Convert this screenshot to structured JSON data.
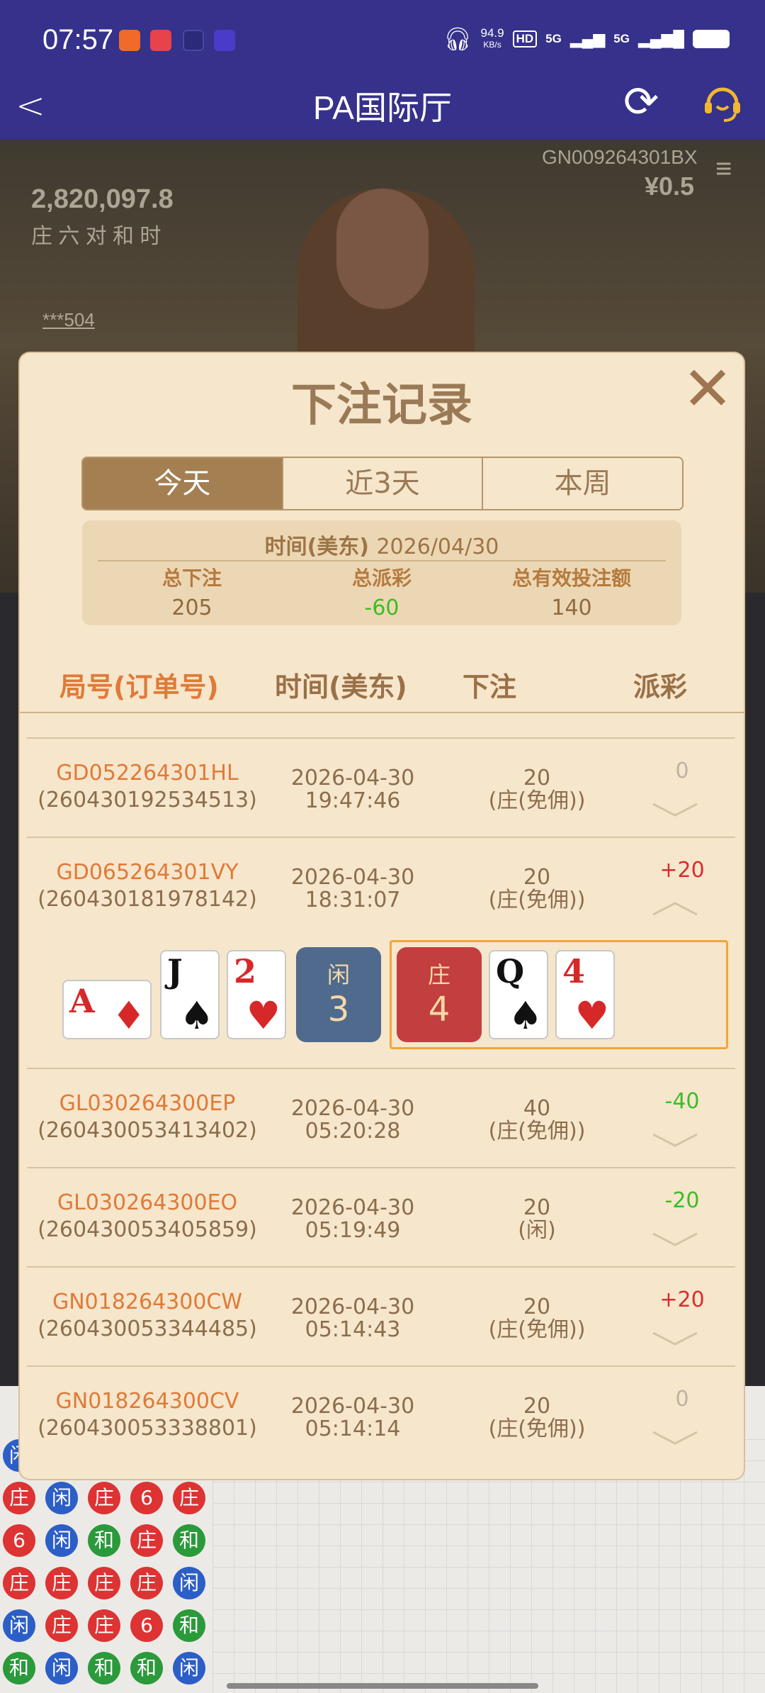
{
  "status_bar": {
    "time": "07:57",
    "net_speed": "94.9",
    "net_unit": "KB/s",
    "sig1": "5G",
    "sig2": "5G",
    "hd": "HD"
  },
  "header": {
    "title": "PA国际厅",
    "back_icon": "back-chevron-icon",
    "refresh_icon": "refresh-icon",
    "support_icon": "customer-service-icon"
  },
  "video": {
    "jackpot": "2,820,097.8",
    "table_code": "GN009264301BX",
    "min_bet": "¥0.5",
    "stats_row": "庄 六 对 和 时",
    "user_suffix": "***504"
  },
  "modal": {
    "title": "下注记录",
    "close_icon": "close-x-icon",
    "tabs": [
      {
        "label": "今天",
        "active": true
      },
      {
        "label": "近3天",
        "active": false
      },
      {
        "label": "本周",
        "active": false
      }
    ],
    "summary": {
      "date_label": "时间(美东)",
      "date": "2026/04/30",
      "total_bet_label": "总下注",
      "total_bet": "205",
      "total_payout_label": "总派彩",
      "total_payout": "-60",
      "valid_bet_label": "总有效投注额",
      "valid_bet": "140"
    },
    "columns": {
      "round": "局号(订单号)",
      "time": "时间(美东)",
      "bet": "下注",
      "payout": "派彩"
    },
    "rows": [
      {
        "round_id": "GD052264301HL",
        "order_no": "(260430192534513)",
        "date": "2026-04-30",
        "clock": "19:47:46",
        "amount": "20",
        "bet_type": "(庄(免佣))",
        "payout": "0",
        "expanded": false
      },
      {
        "round_id": "GD065264301VY",
        "order_no": "(260430181978142)",
        "date": "2026-04-30",
        "clock": "18:31:07",
        "amount": "20",
        "bet_type": "(庄(免佣))",
        "payout": "+20",
        "expanded": true
      },
      {
        "round_id": "GL030264300EP",
        "order_no": "(260430053413402)",
        "date": "2026-04-30",
        "clock": "05:20:28",
        "amount": "40",
        "bet_type": "(庄(免佣))",
        "payout": "-40",
        "expanded": false
      },
      {
        "round_id": "GL030264300EO",
        "order_no": "(260430053405859)",
        "date": "2026-04-30",
        "clock": "05:19:49",
        "amount": "20",
        "bet_type": "(闲)",
        "payout": "-20",
        "expanded": false
      },
      {
        "round_id": "GN018264300CW",
        "order_no": "(260430053344485)",
        "date": "2026-04-30",
        "clock": "05:14:43",
        "amount": "20",
        "bet_type": "(庄(免佣))",
        "payout": "+20",
        "expanded": false
      },
      {
        "round_id": "GN018264300CV",
        "order_no": "(260430053338801)",
        "date": "2026-04-30",
        "clock": "05:14:14",
        "amount": "20",
        "bet_type": "(庄(免佣))",
        "payout": "0",
        "expanded": false
      }
    ],
    "detail": {
      "player_cards": [
        {
          "rank": "A",
          "suit": "♦"
        },
        {
          "rank": "J",
          "suit": "♠"
        },
        {
          "rank": "2",
          "suit": "♥"
        }
      ],
      "player_label": "闲",
      "player_score": "3",
      "banker_label": "庄",
      "banker_score": "4",
      "banker_cards": [
        {
          "rank": "Q",
          "suit": "♠"
        },
        {
          "rank": "4",
          "suit": "♥"
        }
      ]
    }
  },
  "bead_road": [
    [
      "闲",
      "庄",
      "6",
      "庄",
      "闲",
      "和"
    ],
    [
      "",
      "闲",
      "闲",
      "庄",
      "庄",
      "闲"
    ],
    [
      "",
      "庄",
      "和",
      "庄",
      "庄",
      "和"
    ],
    [
      "",
      "6",
      "庄",
      "庄",
      "6",
      "和"
    ],
    [
      "",
      "庄",
      "和",
      "闲",
      "和",
      "闲"
    ]
  ]
}
